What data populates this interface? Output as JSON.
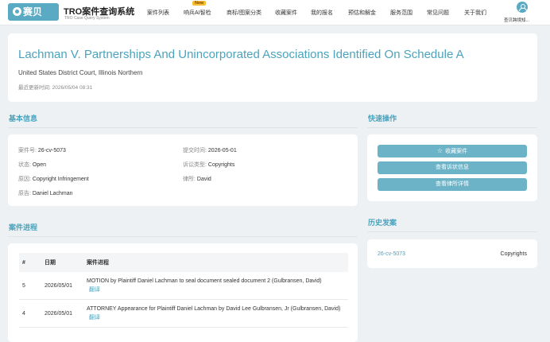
{
  "header": {
    "logo_text": "赛贝",
    "brand_title": "TRO案件查询系统",
    "brand_subtitle": "TRO Case Query System",
    "nav": [
      {
        "label": "案件列表"
      },
      {
        "label": "响兵AI智检",
        "badge": "New"
      },
      {
        "label": "商标/图案分类"
      },
      {
        "label": "收藏案件"
      },
      {
        "label": "我的报名"
      },
      {
        "label": "预估和解金"
      },
      {
        "label": "服务范围"
      },
      {
        "label": "常见问题"
      },
      {
        "label": "关于我们"
      }
    ],
    "user_name": "查贝跨境知..."
  },
  "case": {
    "title": "Lachman V. Partnerships And Unincorporated Associations Identified On Schedule A",
    "court": "United States District Court, Illinois Northern",
    "updated_label": "最近更新时间:",
    "updated_time": "2026/05/04 08:31"
  },
  "basic_info": {
    "section_title": "基本信息",
    "case_no_label": "案件号:",
    "case_no": "26-cv-5073",
    "filed_label": "提交时间:",
    "filed": "2026-05-01",
    "status_label": "状态:",
    "status": "Open",
    "type_label": "诉讼类型:",
    "type": "Copyrights",
    "cause_label": "原因:",
    "cause": "Copyright Infringement",
    "lawyer_label": "律所:",
    "lawyer": "David",
    "plaintiff_label": "原告:",
    "plaintiff": "Daniel Lachman"
  },
  "quick_actions": {
    "section_title": "快速操作",
    "buttons": [
      {
        "label": "收藏案件",
        "icon": "star-icon"
      },
      {
        "label": "查看诉状信息"
      },
      {
        "label": "查看律所详情"
      }
    ]
  },
  "progress": {
    "section_title": "案件进程",
    "headers": [
      "#",
      "日期",
      "案件进程"
    ],
    "translate_label": "翻译",
    "rows": [
      {
        "num": "5",
        "date": "2026/05/01",
        "text": "MOTION by Plaintiff Daniel Lachman to seal document sealed document 2 (Gulbransen, David)"
      },
      {
        "num": "4",
        "date": "2026/05/01",
        "text": "ATTORNEY Appearance for Plaintiff Daniel Lachman by David Lee Gulbransen, Jr (Gulbransen, David)"
      }
    ]
  },
  "history": {
    "section_title": "历史发案",
    "items": [
      {
        "case_no": "26-cv-5073",
        "type": "Copyrights"
      }
    ]
  },
  "colors": {
    "accent": "#4aa3bd",
    "button": "#6cb3c8",
    "background": "#eef1f3"
  }
}
